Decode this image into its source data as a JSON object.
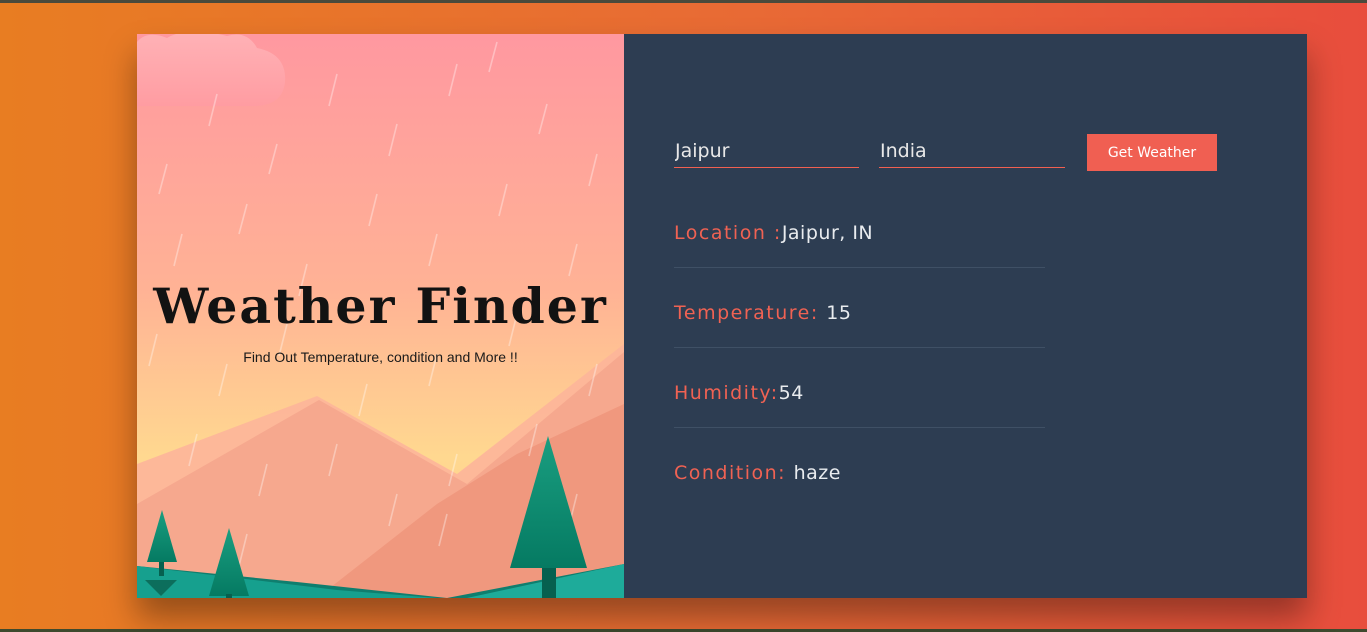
{
  "hero": {
    "title": "Weather Finder",
    "subtitle": "Find Out Temperature, condition and More !!"
  },
  "form": {
    "city_value": "Jaipur",
    "country_value": "India",
    "submit_label": "Get Weather"
  },
  "results": [
    {
      "label": "Location :",
      "value": "Jaipur, IN"
    },
    {
      "label": "Temperature: ",
      "value": "15"
    },
    {
      "label": "Humidity:",
      "value": "54"
    },
    {
      "label": "Condition: ",
      "value": "haze"
    }
  ],
  "colors": {
    "accent": "#f05f52",
    "panel": "#2d3d52",
    "background_start": "#e87d22",
    "background_end": "#e84d3d"
  }
}
